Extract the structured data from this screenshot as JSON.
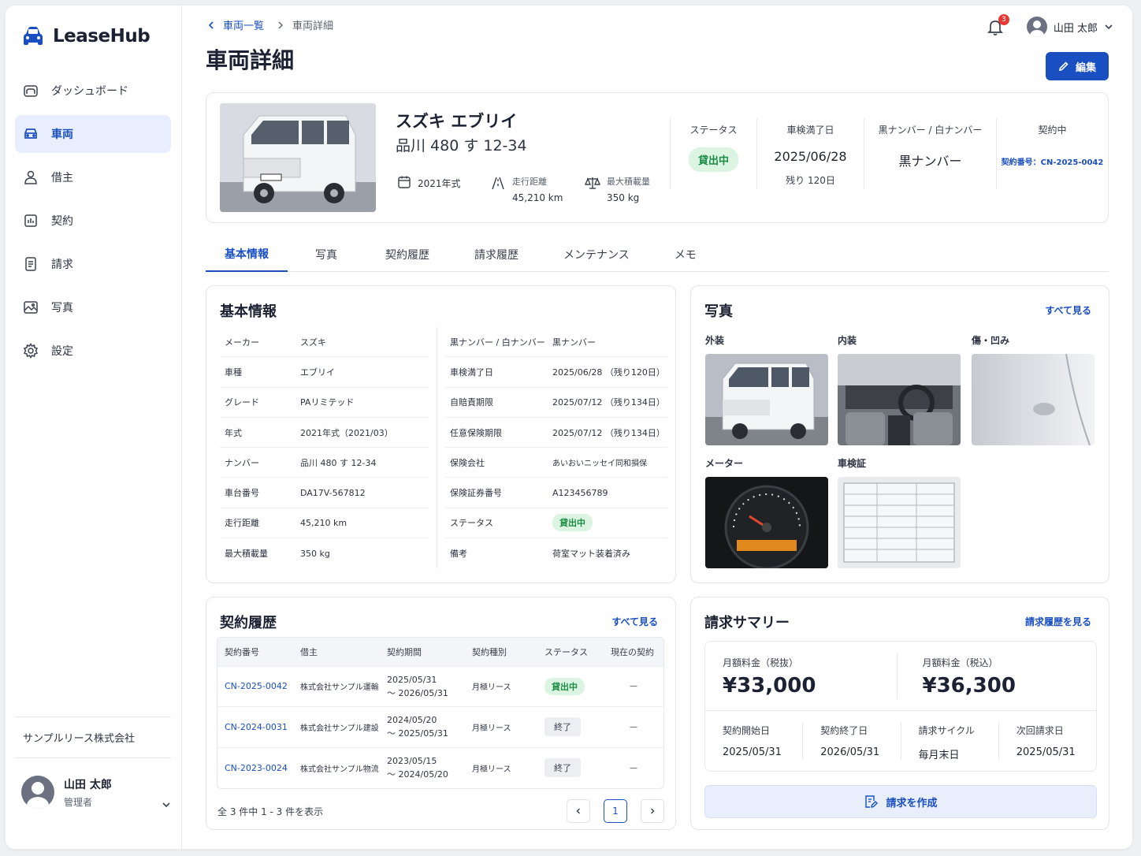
{
  "app": {
    "name": "LeaseHub"
  },
  "sidebar": {
    "items": [
      {
        "label": "ダッシュボード",
        "icon": "dashboard-icon"
      },
      {
        "label": "車両",
        "icon": "car-icon",
        "active": true
      },
      {
        "label": "借主",
        "icon": "user-icon"
      },
      {
        "label": "契約",
        "icon": "contract-icon"
      },
      {
        "label": "請求",
        "icon": "invoice-icon"
      },
      {
        "label": "写真",
        "icon": "photo-icon"
      },
      {
        "label": "設定",
        "icon": "gear-icon"
      }
    ],
    "company": "サンプルリース株式会社",
    "user": {
      "name": "山田 太郎",
      "role": "管理者"
    }
  },
  "header": {
    "breadcrumb": {
      "parent": "車両一覧",
      "current": "車両詳細"
    },
    "title": "車両詳細",
    "notifications": "3",
    "user_name": "山田 太郎",
    "edit_label": "編集"
  },
  "vehicle": {
    "name": "スズキ エブリイ",
    "plate": "品川 480 す 12-34",
    "year": "2021年式",
    "mileage_label": "走行距離",
    "mileage": "45,210 km",
    "load_label": "最大積載量",
    "load": "350 kg",
    "status_label": "ステータス",
    "status": "貸出中",
    "inspection_label": "車検満了日",
    "inspection_date": "2025/06/28",
    "inspection_remaining": "残り 120日",
    "plate_type_label": "黒ナンバー / 白ナンバー",
    "plate_type": "黒ナンバー",
    "contract_label": "契約中",
    "contract_no": "契約番号：CN-2025-0042"
  },
  "tabs": [
    "基本情報",
    "写真",
    "契約履歴",
    "請求履歴",
    "メンテナンス",
    "メモ"
  ],
  "basic_info": {
    "title": "基本情報",
    "left": [
      {
        "k": "メーカー",
        "v": "スズキ"
      },
      {
        "k": "車種",
        "v": "エブリイ"
      },
      {
        "k": "グレード",
        "v": "PAリミテッド"
      },
      {
        "k": "年式",
        "v": "2021年式（2021/03）"
      },
      {
        "k": "ナンバー",
        "v": "品川 480 す 12-34"
      },
      {
        "k": "車台番号",
        "v": "DA17V-567812"
      },
      {
        "k": "走行距離",
        "v": "45,210 km"
      },
      {
        "k": "最大積載量",
        "v": "350 kg"
      }
    ],
    "right": [
      {
        "k": "黒ナンバー / 白ナンバー",
        "v": "黒ナンバー"
      },
      {
        "k": "車検満了日",
        "v": "2025/06/28 （残り120日）"
      },
      {
        "k": "自賠責期限",
        "v": "2025/07/12 （残り134日）"
      },
      {
        "k": "任意保険期限",
        "v": "2025/07/12 （残り134日）"
      },
      {
        "k": "保険会社",
        "v": "あいおいニッセイ同和損保"
      },
      {
        "k": "保険証券番号",
        "v": "A123456789"
      },
      {
        "k": "ステータス",
        "v": "貸出中"
      },
      {
        "k": "備考",
        "v": "荷室マット装着済み"
      }
    ]
  },
  "photos": {
    "title": "写真",
    "see_all": "すべて見る",
    "labels": [
      "外装",
      "内装",
      "傷・凹み",
      "メーター",
      "車検証"
    ]
  },
  "contracts": {
    "title": "契約履歴",
    "see_all": "すべて見る",
    "headers": [
      "契約番号",
      "借主",
      "契約期間",
      "契約種別",
      "ステータス",
      "現在の契約"
    ],
    "rows": [
      {
        "id": "CN-2025-0042",
        "borrower": "株式会社サンプル運輸",
        "from": "2025/05/31",
        "to": "～ 2026/05/31",
        "type": "月極リース",
        "status": "貸出中",
        "current": "—"
      },
      {
        "id": "CN-2024-0031",
        "borrower": "株式会社サンプル建設",
        "from": "2024/05/20",
        "to": "～ 2025/05/31",
        "type": "月極リース",
        "status": "終了",
        "current": "—"
      },
      {
        "id": "CN-2023-0024",
        "borrower": "株式会社サンプル物流",
        "from": "2023/05/15",
        "to": "～ 2024/05/20",
        "type": "月極リース",
        "status": "終了",
        "current": "—"
      }
    ],
    "pager_text": "全 3 件中 1 - 3 件を表示",
    "page": "1"
  },
  "billing": {
    "title": "請求サマリー",
    "link": "請求履歴を見る",
    "monthly_ex_label": "月額料金（税抜）",
    "monthly_ex": "¥33,000",
    "monthly_in_label": "月額料金（税込）",
    "monthly_in": "¥36,300",
    "details": [
      {
        "label": "契約開始日",
        "value": "2025/05/31"
      },
      {
        "label": "契約終了日",
        "value": "2026/05/31"
      },
      {
        "label": "請求サイクル",
        "value": "毎月末日"
      },
      {
        "label": "次回請求日",
        "value": "2025/05/31"
      }
    ],
    "create_label": "請求を作成"
  },
  "colors": {
    "accent": "#1a4fc2",
    "status_green": "#1a8c44"
  }
}
